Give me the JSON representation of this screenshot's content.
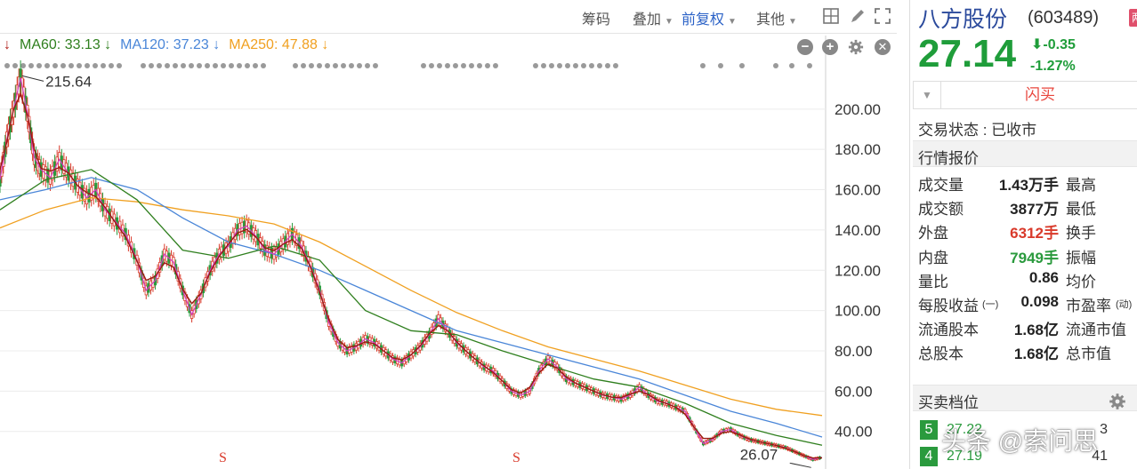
{
  "toolbar": {
    "chip": "筹码",
    "overlay": "叠加",
    "adjust": "前复权",
    "other": "其他"
  },
  "ma_legend": [
    {
      "label": "↓",
      "color": "#b1201b"
    },
    {
      "label": "MA60: 33.13 ↓",
      "color": "#2f7f1e"
    },
    {
      "label": "MA120: 37.23 ↓",
      "color": "#4a86d8"
    },
    {
      "label": "MA250: 47.88 ↓",
      "color": "#f0a020"
    }
  ],
  "chart_controls": {
    "minus": "−",
    "plus": "+"
  },
  "chart_data": {
    "type": "line",
    "ylim": [
      24,
      218
    ],
    "y_ticks": [
      "200.00",
      "180.00",
      "160.00",
      "140.00",
      "120.00",
      "100.00",
      "80.00",
      "60.00",
      "40.00"
    ],
    "y_tick_values": [
      200,
      180,
      160,
      140,
      120,
      100,
      80,
      60,
      40
    ],
    "max_marker": {
      "label": "215.64",
      "value": 215.64
    },
    "min_marker": {
      "label": "26.07",
      "value": 26.07
    },
    "s_markers": [
      "S",
      "S"
    ],
    "price_path": [
      [
        0,
        165
      ],
      [
        3,
        185
      ],
      [
        6,
        200
      ],
      [
        9,
        215.6
      ],
      [
        12,
        198
      ],
      [
        15,
        176
      ],
      [
        18,
        170
      ],
      [
        22,
        166
      ],
      [
        26,
        175
      ],
      [
        30,
        168
      ],
      [
        34,
        162
      ],
      [
        38,
        156
      ],
      [
        42,
        160
      ],
      [
        46,
        150
      ],
      [
        50,
        145
      ],
      [
        55,
        138
      ],
      [
        60,
        125
      ],
      [
        64,
        110
      ],
      [
        68,
        115
      ],
      [
        72,
        128
      ],
      [
        76,
        124
      ],
      [
        80,
        110
      ],
      [
        84,
        98
      ],
      [
        88,
        108
      ],
      [
        92,
        120
      ],
      [
        96,
        128
      ],
      [
        100,
        132
      ],
      [
        104,
        140
      ],
      [
        108,
        142
      ],
      [
        112,
        137
      ],
      [
        116,
        130
      ],
      [
        120,
        128
      ],
      [
        124,
        133
      ],
      [
        128,
        138
      ],
      [
        132,
        132
      ],
      [
        136,
        122
      ],
      [
        140,
        110
      ],
      [
        144,
        94
      ],
      [
        148,
        84
      ],
      [
        152,
        80
      ],
      [
        156,
        82
      ],
      [
        160,
        86
      ],
      [
        164,
        84
      ],
      [
        168,
        80
      ],
      [
        172,
        76
      ],
      [
        176,
        74
      ],
      [
        180,
        78
      ],
      [
        184,
        82
      ],
      [
        188,
        88
      ],
      [
        192,
        96
      ],
      [
        196,
        90
      ],
      [
        200,
        84
      ],
      [
        204,
        80
      ],
      [
        208,
        76
      ],
      [
        212,
        72
      ],
      [
        216,
        70
      ],
      [
        220,
        65
      ],
      [
        224,
        60
      ],
      [
        228,
        58
      ],
      [
        232,
        60
      ],
      [
        236,
        70
      ],
      [
        240,
        76
      ],
      [
        244,
        72
      ],
      [
        248,
        66
      ],
      [
        252,
        64
      ],
      [
        256,
        62
      ],
      [
        260,
        60
      ],
      [
        264,
        58
      ],
      [
        268,
        57
      ],
      [
        272,
        56
      ],
      [
        276,
        58
      ],
      [
        280,
        62
      ],
      [
        284,
        58
      ],
      [
        288,
        55
      ],
      [
        292,
        54
      ],
      [
        296,
        52
      ],
      [
        300,
        50
      ],
      [
        304,
        42
      ],
      [
        308,
        34
      ],
      [
        312,
        36
      ],
      [
        316,
        40
      ],
      [
        320,
        41
      ],
      [
        324,
        38
      ],
      [
        328,
        36
      ],
      [
        332,
        35
      ],
      [
        336,
        34
      ],
      [
        340,
        33
      ],
      [
        344,
        32
      ],
      [
        348,
        30
      ],
      [
        352,
        28
      ],
      [
        356,
        26.07
      ],
      [
        360,
        27.14
      ]
    ],
    "ma60_path": [
      [
        0,
        150
      ],
      [
        20,
        165
      ],
      [
        40,
        170
      ],
      [
        60,
        155
      ],
      [
        80,
        130
      ],
      [
        100,
        126
      ],
      [
        120,
        132
      ],
      [
        140,
        125
      ],
      [
        160,
        100
      ],
      [
        180,
        90
      ],
      [
        200,
        88
      ],
      [
        220,
        80
      ],
      [
        240,
        73
      ],
      [
        260,
        66
      ],
      [
        280,
        62
      ],
      [
        300,
        54
      ],
      [
        320,
        44
      ],
      [
        340,
        38
      ],
      [
        360,
        33.13
      ]
    ],
    "ma120_path": [
      [
        0,
        155
      ],
      [
        20,
        160
      ],
      [
        40,
        166
      ],
      [
        60,
        160
      ],
      [
        80,
        146
      ],
      [
        100,
        134
      ],
      [
        120,
        128
      ],
      [
        140,
        120
      ],
      [
        160,
        110
      ],
      [
        180,
        100
      ],
      [
        200,
        90
      ],
      [
        220,
        84
      ],
      [
        240,
        78
      ],
      [
        260,
        72
      ],
      [
        280,
        66
      ],
      [
        300,
        58
      ],
      [
        320,
        50
      ],
      [
        340,
        44
      ],
      [
        360,
        37.23
      ]
    ],
    "ma250_path": [
      [
        0,
        141
      ],
      [
        20,
        150
      ],
      [
        40,
        156
      ],
      [
        60,
        154
      ],
      [
        80,
        150
      ],
      [
        100,
        147
      ],
      [
        120,
        143
      ],
      [
        140,
        134
      ],
      [
        160,
        122
      ],
      [
        180,
        110
      ],
      [
        200,
        99
      ],
      [
        220,
        90
      ],
      [
        240,
        82
      ],
      [
        260,
        76
      ],
      [
        280,
        70
      ],
      [
        300,
        63
      ],
      [
        320,
        56
      ],
      [
        340,
        51
      ],
      [
        360,
        47.88
      ]
    ]
  },
  "quote": {
    "name": "八方股份",
    "code": "(603489)",
    "badge": "两融",
    "price": "27.14",
    "change": "-0.35",
    "change_pct": "-1.27%",
    "flash_buy": "闪买",
    "trade_status": "交易状态 : 已收市",
    "section_quote": "行情报价",
    "rows": [
      {
        "label": "成交量",
        "value": "1.43万手",
        "label2": "最高",
        "color": ""
      },
      {
        "label": "成交额",
        "value": "3877万",
        "label2": "最低",
        "color": ""
      },
      {
        "label": "外盘",
        "value": "6312手",
        "label2": "换手",
        "color": "red"
      },
      {
        "label": "内盘",
        "value": "7949手",
        "label2": "振幅",
        "color": "green"
      },
      {
        "label": "量比",
        "value": "0.86",
        "label2": "均价",
        "color": ""
      },
      {
        "label": "每股收益",
        "label_small": "(一)",
        "value": "0.098",
        "label2": "市盈率",
        "label2_small": "(动)",
        "color": ""
      },
      {
        "label": "流通股本",
        "value": "1.68亿",
        "label2": "流通市值",
        "color": ""
      },
      {
        "label": "总股本",
        "value": "1.68亿",
        "label2": "总市值",
        "color": ""
      }
    ],
    "section_book": "买卖档位",
    "levels": [
      {
        "num": "5",
        "price": "27.22",
        "vol": "3"
      },
      {
        "num": "4",
        "price": "27.19",
        "vol": "41"
      }
    ]
  },
  "watermark": "头条 @索问思",
  "colors": {
    "price_line": "#9a1a12",
    "ma5": "#d33cc0",
    "ma60": "#2f7f1e",
    "ma120": "#4a86d8",
    "ma250": "#f0a020",
    "up": "#d93a2b",
    "down": "#2a9a3d"
  }
}
